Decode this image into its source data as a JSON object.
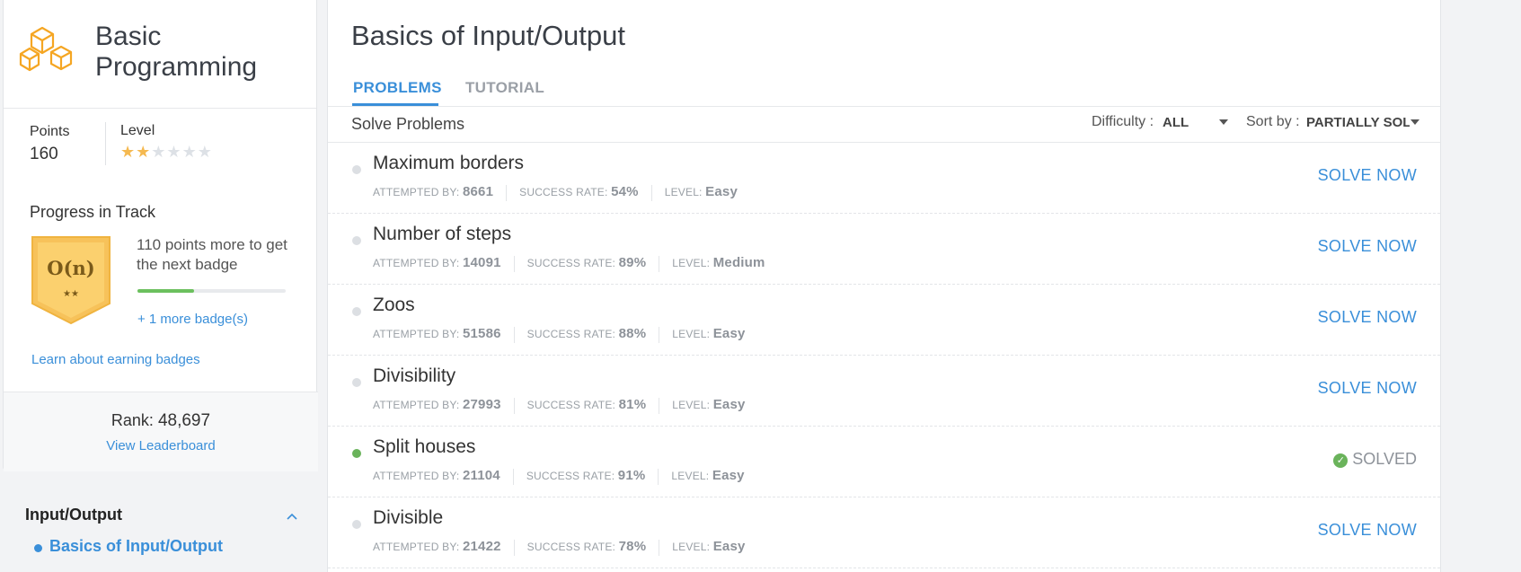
{
  "sidebar": {
    "track_title_line1": "Basic",
    "track_title_line2": "Programming",
    "points_label": "Points",
    "points_value": "160",
    "level_label": "Level",
    "level_stars": 2,
    "level_stars_max": 6,
    "progress_title": "Progress in Track",
    "badge_text": "O(n)",
    "badge_stars": "★★",
    "next_badge_text": "110 points more to get the next badge",
    "progress_fraction": 0.38,
    "more_badges": "+ 1 more badge(s)",
    "learn_link": "Learn about earning badges",
    "rank_label": "Rank:",
    "rank_value": "48,697",
    "leaderboard_link": "View Leaderboard",
    "section_title": "Input/Output",
    "nav_item": "Basics of Input/Output"
  },
  "main": {
    "title": "Basics of Input/Output",
    "tabs": [
      {
        "label": "PROBLEMS",
        "active": true
      },
      {
        "label": "TUTORIAL",
        "active": false
      }
    ],
    "toolbar": {
      "solve_label": "Solve Problems",
      "difficulty_label": "Difficulty :",
      "difficulty_value": "ALL",
      "sort_label": "Sort by :",
      "sort_value": "PARTIALLY SOL"
    },
    "meta_labels": {
      "attempted": "Attempted by:",
      "success": "Success rate:",
      "level": "Level:"
    },
    "problems": [
      {
        "title": "Maximum borders",
        "attempted": "8661",
        "success": "54%",
        "level": "Easy",
        "action": "SOLVE NOW",
        "solved": false
      },
      {
        "title": "Number of steps",
        "attempted": "14091",
        "success": "89%",
        "level": "Medium",
        "action": "SOLVE NOW",
        "solved": false
      },
      {
        "title": "Zoos",
        "attempted": "51586",
        "success": "88%",
        "level": "Easy",
        "action": "SOLVE NOW",
        "solved": false
      },
      {
        "title": "Divisibility",
        "attempted": "27993",
        "success": "81%",
        "level": "Easy",
        "action": "SOLVE NOW",
        "solved": false
      },
      {
        "title": "Split houses",
        "attempted": "21104",
        "success": "91%",
        "level": "Easy",
        "action": "SOLVED",
        "solved": true
      },
      {
        "title": "Divisible",
        "attempted": "21422",
        "success": "78%",
        "level": "Easy",
        "action": "SOLVE NOW",
        "solved": false
      }
    ]
  },
  "colors": {
    "accent": "#3a8fd9",
    "star": "#f5b950",
    "badge": "#f7c25a",
    "success": "#6ab35b"
  },
  "icons": [
    "cubes-icon",
    "chevron-up-icon",
    "caret-down-icon",
    "check-circle-icon",
    "star-icon",
    "badge-icon"
  ]
}
